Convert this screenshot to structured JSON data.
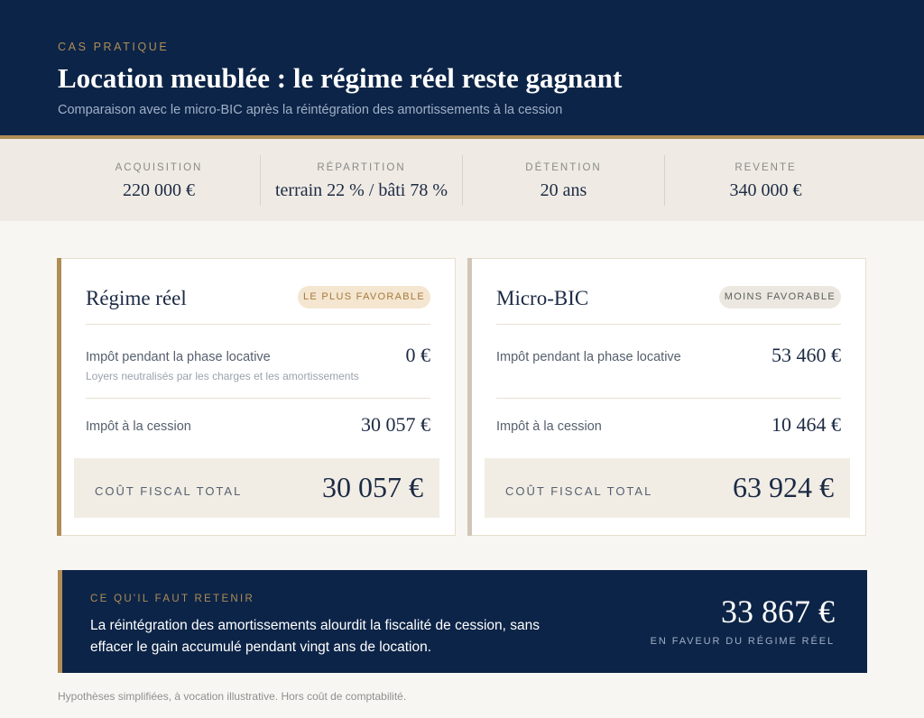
{
  "header": {
    "eyebrow": "CAS PRATIQUE",
    "title": "Location meublée : le régime réel reste gagnant",
    "subtitle": "Comparaison avec le micro-BIC après la réintégration des amortissements à la cession"
  },
  "facts": [
    {
      "label": "ACQUISITION",
      "value": "220 000 €"
    },
    {
      "label": "RÉPARTITION",
      "value": "terrain 22 % / bâti 78 %"
    },
    {
      "label": "DÉTENTION",
      "value": "20 ans"
    },
    {
      "label": "REVENTE",
      "value": "340 000 €"
    }
  ],
  "cards": [
    {
      "title": "Régime réel",
      "badge": "LE PLUS FAVORABLE",
      "rows": [
        {
          "label": "Impôt pendant la phase locative",
          "note": "Loyers neutralisés par les charges et les amortissements",
          "value": "0 €"
        },
        {
          "label": "Impôt à la cession",
          "value": "30 057 €"
        }
      ],
      "total_label": "COÛT FISCAL TOTAL",
      "total_value": "30 057 €"
    },
    {
      "title": "Micro-BIC",
      "badge": "MOINS FAVORABLE",
      "rows": [
        {
          "label": "Impôt pendant la phase locative",
          "value": "53 460 €"
        },
        {
          "label": "Impôt à la cession",
          "value": "10 464 €"
        }
      ],
      "total_label": "COÛT FISCAL TOTAL",
      "total_value": "63 924 €"
    }
  ],
  "takeaway": {
    "eyebrow": "CE QU'IL FAUT RETENIR",
    "text": "La réintégration des amortissements alourdit la fiscalité de cession, sans effacer le gain accumulé pendant vingt ans de location.",
    "amount": "33 867 €",
    "caption": "EN FAVEUR DU RÉGIME RÉEL"
  },
  "footnote": "Hypothèses simplifiées, à vocation illustrative. Hors coût de comptabilité.",
  "colors": {
    "navy": "#0c2447",
    "gold": "#b08d57",
    "sand": "#efebe4",
    "muted_bar": "#cfc6b6"
  }
}
